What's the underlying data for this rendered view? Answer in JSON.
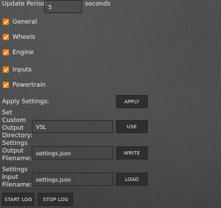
{
  "update_period": {
    "label": "Update Period:",
    "value": "5",
    "unit": "seconds"
  },
  "checkboxes": [
    {
      "label": "General",
      "checked": true
    },
    {
      "label": "Wheels",
      "checked": true
    },
    {
      "label": "Engine",
      "checked": true
    },
    {
      "label": "Inputs",
      "checked": true
    },
    {
      "label": "Powertrain",
      "checked": true
    }
  ],
  "apply_settings": {
    "label": "Apply Settings:",
    "button": "APPLY"
  },
  "custom_output": {
    "label_lines": [
      "Set",
      "Custom",
      "Output",
      "Directory:"
    ],
    "value": "VSL",
    "button": "USE"
  },
  "settings_output": {
    "label_lines": [
      "Settings",
      "Output",
      "Filename:"
    ],
    "value": "settings.json",
    "button": "WRITE"
  },
  "settings_input": {
    "label_lines": [
      "Settings",
      "Input",
      "Filename:"
    ],
    "value": "settings.json",
    "button": "LOAD"
  },
  "log_buttons": {
    "start": "START LOG",
    "stop": "STOP LOG"
  },
  "colors": {
    "accent": "#e8821e",
    "button_bg": "#2f2f2f"
  }
}
